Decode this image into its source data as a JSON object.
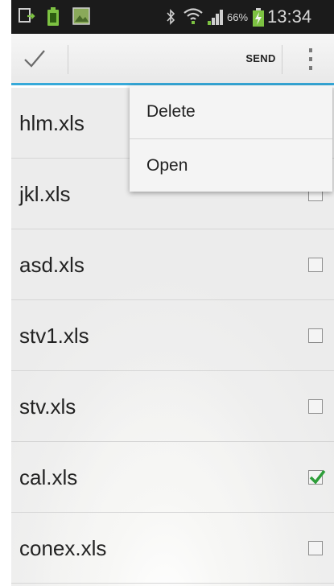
{
  "status_bar": {
    "battery_percent": "66%",
    "time": "13:34",
    "icons": [
      "screenshot-icon",
      "battery-saver-icon",
      "gallery-icon",
      "bluetooth-icon",
      "wifi-icon",
      "signal-icon",
      "battery-charging-icon"
    ]
  },
  "action_bar": {
    "confirm_icon": "check-icon",
    "send_label": "SEND",
    "overflow_icon": "overflow-menu-icon",
    "accent_color": "#36a9d9"
  },
  "files": [
    {
      "name": "hlm.xls",
      "checked": false
    },
    {
      "name": "jkl.xls",
      "checked": false
    },
    {
      "name": "asd.xls",
      "checked": false
    },
    {
      "name": "stv1.xls",
      "checked": false
    },
    {
      "name": "stv.xls",
      "checked": false
    },
    {
      "name": "cal.xls",
      "checked": true
    },
    {
      "name": "conex.xls",
      "checked": false
    }
  ],
  "menu": {
    "items": [
      {
        "label": "Delete"
      },
      {
        "label": "Open"
      }
    ]
  },
  "colors": {
    "check_mark": "#2e9e3a"
  }
}
